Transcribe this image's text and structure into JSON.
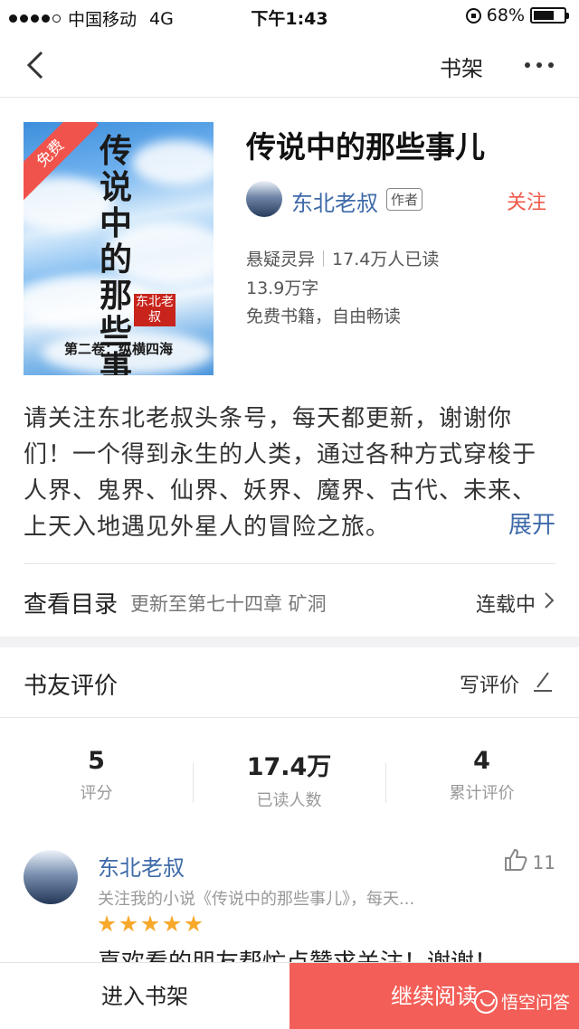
{
  "status_bar": {
    "carrier": "中国移动",
    "network": "4G",
    "time": "下午1:43",
    "battery": "68%",
    "battery_level": 0.68
  },
  "nav": {
    "shelf_label": "书架"
  },
  "book": {
    "cover_badge": "免费",
    "cover_title": "传说中的那些事",
    "cover_seal": "东北老叔",
    "cover_subtitle": "第二卷：纵横四海",
    "title": "传说中的那些事儿",
    "author": "东北老叔",
    "author_tag": "作者",
    "follow_label": "关注",
    "genre": "悬疑灵异",
    "readers": "17.4万人已读",
    "word_count": "13.9万字",
    "license": "免费书籍，自由畅读"
  },
  "intro": {
    "text": "请关注东北老叔头条号，每天都更新，谢谢你们！一个得到永生的人类，通过各种方式穿梭于人界、鬼界、仙界、妖界、魔界、古代、未来、上天入地遇见外星人的冒险之旅。",
    "expand_label": "展开"
  },
  "toc": {
    "label": "查看目录",
    "update": "更新至第七十四章 矿洞",
    "status": "连载中"
  },
  "reviews": {
    "title": "书友评价",
    "write_label": "写评价",
    "stats": [
      {
        "value": "5",
        "label": "评分"
      },
      {
        "value": "17.4万",
        "label": "已读人数"
      },
      {
        "value": "4",
        "label": "累计评价"
      }
    ],
    "first": {
      "name": "东北老叔",
      "likes": "11",
      "subtitle": "关注我的小说《传说中的那些事儿》，每天...",
      "stars": 5,
      "body": "喜欢看的朋友帮忙点赞求关注！谢谢！"
    }
  },
  "bottom": {
    "add_shelf": "进入书架",
    "continue": "继续阅读",
    "watermark": "悟空问答"
  },
  "colors": {
    "accent": "#f35f58",
    "link": "#3e6aa8",
    "star": "#f7a92c"
  }
}
